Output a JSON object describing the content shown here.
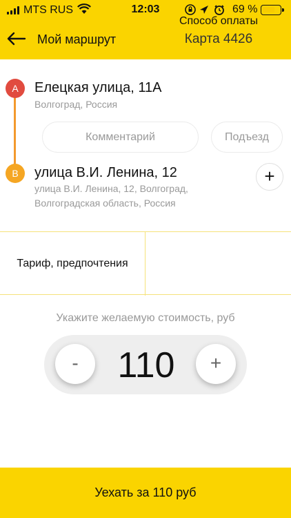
{
  "status_bar": {
    "carrier": "MTS RUS",
    "time": "12:03",
    "battery_percent": "69 %",
    "battery_level": 0.69
  },
  "header": {
    "title": "Мой маршрут",
    "back_icon": "arrow-left-icon"
  },
  "route": {
    "point_a": {
      "marker": "A",
      "title": "Елецкая улица, 11А",
      "subtitle": "Волгоград, Россия"
    },
    "comment_label": "Комментарий",
    "entrance_label": "Подъезд",
    "point_b": {
      "marker": "B",
      "title": "улица В.И. Ленина, 12",
      "subtitle_line1": "улица В.И. Ленина, 12, Волгоград,",
      "subtitle_line2": "Волгоградская область, Россия"
    },
    "add_stop_icon": "plus-icon",
    "add_stop_label": "+"
  },
  "options": {
    "tariff_label": "Тариф, предпочтения",
    "payment_title": "Способ оплаты",
    "payment_value": "Карта 4426"
  },
  "price": {
    "label": "Укажите желаемую стоимость, руб",
    "value": "110",
    "minus_label": "-",
    "plus_label": "+"
  },
  "go_button": {
    "label": "Уехать за 110 руб"
  },
  "colors": {
    "accent": "#fad400",
    "marker_a": "#e14b3f",
    "marker_b": "#f5a623",
    "route_line": "#f3992d"
  }
}
